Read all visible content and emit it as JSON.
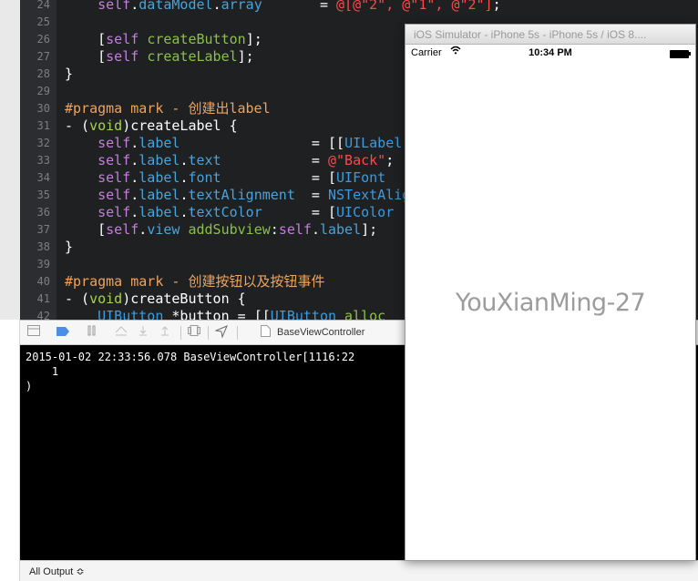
{
  "editor": {
    "lines": [
      {
        "n": "24",
        "tokens": [
          {
            "t": "    "
          },
          {
            "t": "self",
            "c": "self"
          },
          {
            "t": "."
          },
          {
            "t": "dataModel",
            "c": "prop"
          },
          {
            "t": "."
          },
          {
            "t": "array",
            "c": "prop"
          },
          {
            "t": "       = "
          },
          {
            "t": "@[@\"2\", @\"1\", @\"2\"]",
            "c": "str"
          },
          {
            "t": ";"
          }
        ]
      },
      {
        "n": "25",
        "tokens": []
      },
      {
        "n": "26",
        "tokens": [
          {
            "t": "    ["
          },
          {
            "t": "self",
            "c": "self"
          },
          {
            "t": " "
          },
          {
            "t": "createButton",
            "c": "sel"
          },
          {
            "t": "];"
          }
        ]
      },
      {
        "n": "27",
        "tokens": [
          {
            "t": "    ["
          },
          {
            "t": "self",
            "c": "self"
          },
          {
            "t": " "
          },
          {
            "t": "createLabel",
            "c": "sel"
          },
          {
            "t": "];"
          }
        ]
      },
      {
        "n": "28",
        "tokens": [
          {
            "t": "}"
          }
        ]
      },
      {
        "n": "29",
        "tokens": []
      },
      {
        "n": "30",
        "tokens": [
          {
            "t": "#pragma mark - 创建出label",
            "c": "prag"
          }
        ]
      },
      {
        "n": "31",
        "tokens": [
          {
            "t": "- ("
          },
          {
            "t": "void",
            "c": "void"
          },
          {
            "t": ")createLabel {"
          }
        ]
      },
      {
        "n": "32",
        "tokens": [
          {
            "t": "    "
          },
          {
            "t": "self",
            "c": "self"
          },
          {
            "t": "."
          },
          {
            "t": "label",
            "c": "prop"
          },
          {
            "t": "                = [["
          },
          {
            "t": "UILabel",
            "c": "cls"
          }
        ]
      },
      {
        "n": "33",
        "tokens": [
          {
            "t": "    "
          },
          {
            "t": "self",
            "c": "self"
          },
          {
            "t": "."
          },
          {
            "t": "label",
            "c": "prop"
          },
          {
            "t": "."
          },
          {
            "t": "text",
            "c": "prop"
          },
          {
            "t": "           = "
          },
          {
            "t": "@\"Back\"",
            "c": "str"
          },
          {
            "t": ";"
          }
        ]
      },
      {
        "n": "34",
        "tokens": [
          {
            "t": "    "
          },
          {
            "t": "self",
            "c": "self"
          },
          {
            "t": "."
          },
          {
            "t": "label",
            "c": "prop"
          },
          {
            "t": "."
          },
          {
            "t": "font",
            "c": "prop"
          },
          {
            "t": "           = ["
          },
          {
            "t": "UIFont",
            "c": "cls"
          }
        ]
      },
      {
        "n": "35",
        "tokens": [
          {
            "t": "    "
          },
          {
            "t": "self",
            "c": "self"
          },
          {
            "t": "."
          },
          {
            "t": "label",
            "c": "prop"
          },
          {
            "t": "."
          },
          {
            "t": "textAlignment",
            "c": "prop"
          },
          {
            "t": "  = "
          },
          {
            "t": "NSTextAlignment",
            "c": "cls"
          }
        ]
      },
      {
        "n": "36",
        "tokens": [
          {
            "t": "    "
          },
          {
            "t": "self",
            "c": "self"
          },
          {
            "t": "."
          },
          {
            "t": "label",
            "c": "prop"
          },
          {
            "t": "."
          },
          {
            "t": "textColor",
            "c": "prop"
          },
          {
            "t": "      = ["
          },
          {
            "t": "UIColor",
            "c": "cls"
          }
        ]
      },
      {
        "n": "37",
        "tokens": [
          {
            "t": "    ["
          },
          {
            "t": "self",
            "c": "self"
          },
          {
            "t": "."
          },
          {
            "t": "view",
            "c": "prop"
          },
          {
            "t": " "
          },
          {
            "t": "addSubview",
            "c": "sel"
          },
          {
            "t": ":"
          },
          {
            "t": "self",
            "c": "self"
          },
          {
            "t": "."
          },
          {
            "t": "label",
            "c": "prop"
          },
          {
            "t": "];"
          }
        ]
      },
      {
        "n": "38",
        "tokens": [
          {
            "t": "}"
          }
        ]
      },
      {
        "n": "39",
        "tokens": []
      },
      {
        "n": "40",
        "tokens": [
          {
            "t": "#pragma mark - 创建按钮以及按钮事件",
            "c": "prag"
          }
        ]
      },
      {
        "n": "41",
        "tokens": [
          {
            "t": "- ("
          },
          {
            "t": "void",
            "c": "void"
          },
          {
            "t": ")createButton {"
          }
        ]
      },
      {
        "n": "42",
        "tokens": [
          {
            "t": "    "
          },
          {
            "t": "UIButton",
            "c": "cls"
          },
          {
            "t": " *button = [["
          },
          {
            "t": "UIButton",
            "c": "cls"
          },
          {
            "t": " alloc",
            "c": "sel"
          }
        ]
      }
    ]
  },
  "debugbar": {
    "icons": [
      "console-toggle-icon",
      "breakpoint-icon",
      "pause-icon",
      "step-over-icon",
      "step-into-icon",
      "step-out-icon",
      "view-debug-icon",
      "location-icon",
      "file-icon"
    ],
    "breadcrumb": "BaseViewController"
  },
  "console": {
    "lines": [
      "2015-01-02 22:33:56.078 BaseViewController[1116:22",
      "    1",
      ")"
    ]
  },
  "outputbar": {
    "selector": "All Output ≎"
  },
  "simulator": {
    "title": "iOS Simulator - iPhone 5s - iPhone 5s / iOS 8....",
    "carrier": "Carrier",
    "time": "10:34 PM",
    "label": "YouXianMing-27"
  },
  "colors": {
    "editor_bg": "#1e2022",
    "self": "#c47fdb",
    "property": "#4aa3d9",
    "selector": "#8ac04a",
    "string": "#ff4949",
    "pragma": "#f0a35c",
    "class": "#3b9be0"
  }
}
